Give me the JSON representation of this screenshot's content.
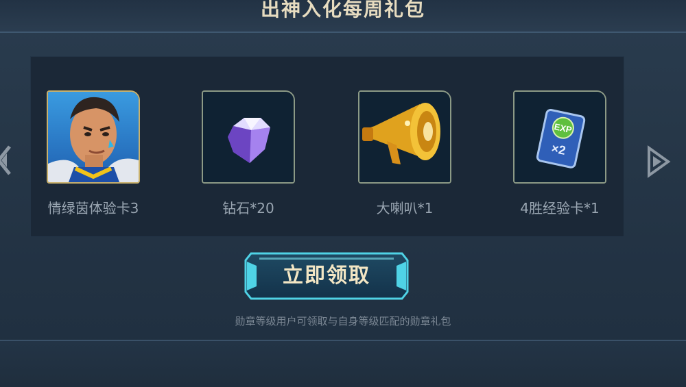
{
  "header": {
    "title": "出神入化每周礼包"
  },
  "rewards": [
    {
      "label": "情绿茵体验卡3",
      "icon": "hero-portrait-icon"
    },
    {
      "label": "钻石*20",
      "icon": "diamond-icon"
    },
    {
      "label": "大喇叭*1",
      "icon": "megaphone-icon"
    },
    {
      "label": "4胜经验卡*1",
      "icon": "exp-card-icon"
    }
  ],
  "claim_button": {
    "label": "立即领取"
  },
  "hint": "勋章等级用户可领取与自身等级匹配的勋章礼包",
  "exp_card": {
    "badge": "EXP",
    "multiplier": "×2"
  },
  "colors": {
    "accent_gold": "#e7dcc0",
    "button_cyan": "#4fd3e6",
    "label_grey": "#9aa6b2"
  }
}
